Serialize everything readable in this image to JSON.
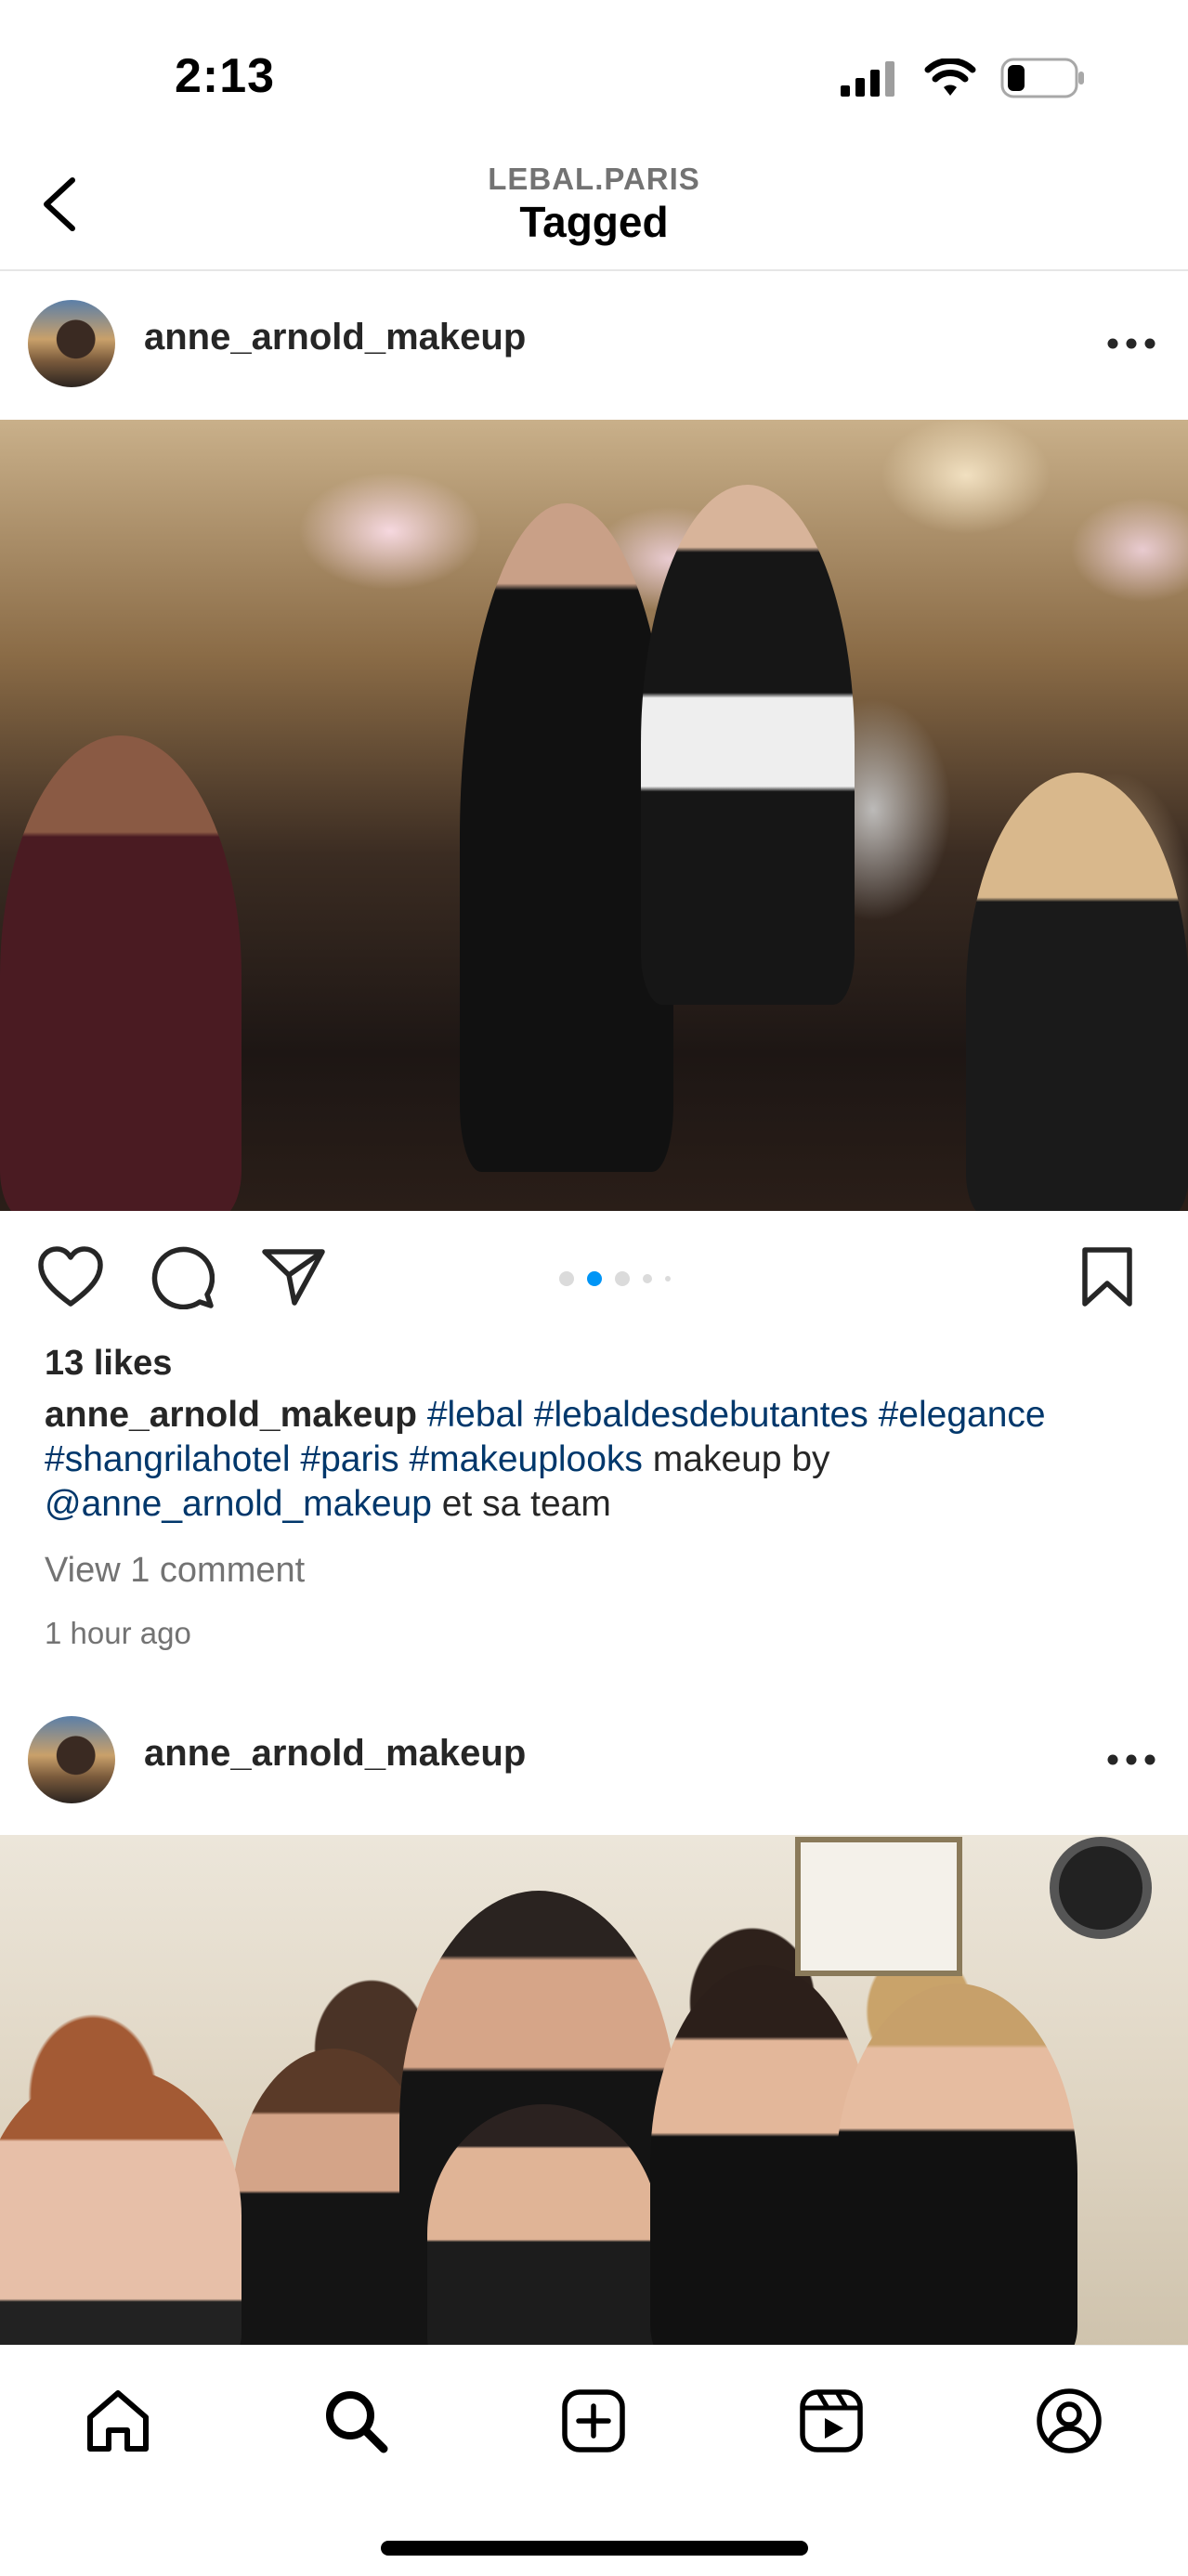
{
  "status_bar": {
    "time": "2:13",
    "icons": [
      "cellular-signal-icon",
      "wifi-icon",
      "battery-icon"
    ],
    "battery_level": 0.2
  },
  "header": {
    "subtitle": "LEBAL.PARIS",
    "title": "Tagged",
    "back_icon": "chevron-left-icon"
  },
  "posts": [
    {
      "username": "anne_arnold_makeup",
      "more_icon": "more-horizontal-icon",
      "image_alt": "Débutante ball ballroom scene",
      "carousel": {
        "count": 5,
        "active_index": 1
      },
      "likes": "13 likes",
      "caption": {
        "user": "anne_arnold_makeup",
        "segments": [
          {
            "text": "#lebal",
            "type": "tag"
          },
          {
            "text": " ",
            "type": "text"
          },
          {
            "text": "#lebaldesdebutantes",
            "type": "tag"
          },
          {
            "text": " ",
            "type": "text"
          },
          {
            "text": "#elegance",
            "type": "tag"
          },
          {
            "text": " ",
            "type": "text"
          },
          {
            "text": "#shangrilahotel",
            "type": "tag"
          },
          {
            "text": " ",
            "type": "text"
          },
          {
            "text": "#paris",
            "type": "tag"
          },
          {
            "text": " ",
            "type": "text"
          },
          {
            "text": "#makeuplooks",
            "type": "tag"
          },
          {
            "text": " makeup by ",
            "type": "text"
          },
          {
            "text": "@anne_arnold_makeup",
            "type": "tag"
          },
          {
            "text": " et sa team",
            "type": "text"
          }
        ]
      },
      "view_comments": "View 1 comment",
      "time_ago": "1 hour ago"
    },
    {
      "username": "anne_arnold_makeup",
      "more_icon": "more-horizontal-icon",
      "image_alt": "Group selfie of makeup team"
    }
  ],
  "actions": {
    "like_icon": "heart-icon",
    "comment_icon": "comment-icon",
    "share_icon": "send-icon",
    "save_icon": "bookmark-icon"
  },
  "bottom_nav": {
    "items": [
      "home-icon",
      "search-icon",
      "create-icon",
      "reels-icon",
      "profile-icon"
    ]
  },
  "colors": {
    "link": "#00376b",
    "secondary_text": "#737373",
    "carousel_active": "#0095f6"
  }
}
